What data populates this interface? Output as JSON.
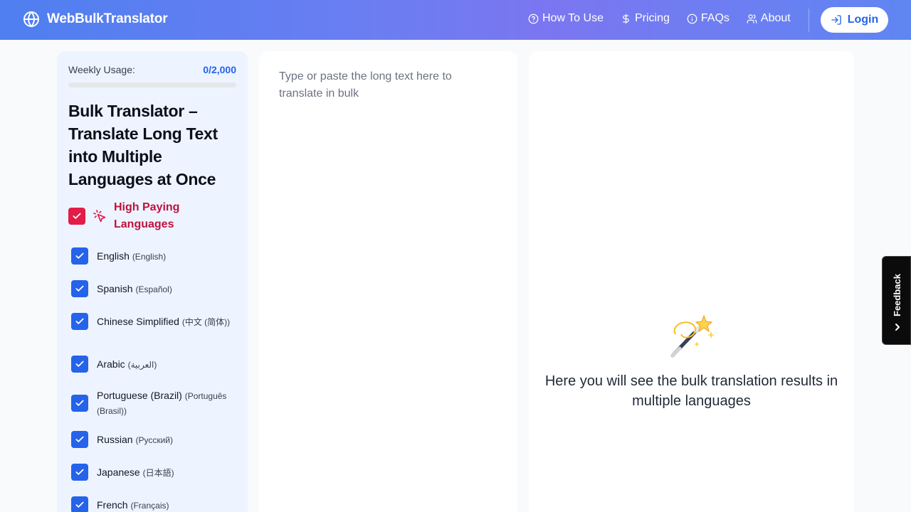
{
  "header": {
    "brand": "WebBulkTranslator",
    "nav": [
      {
        "label": "How To Use",
        "icon": "question-circle-icon"
      },
      {
        "label": "Pricing",
        "icon": "dollar-icon"
      },
      {
        "label": "FAQs",
        "icon": "info-circle-icon"
      },
      {
        "label": "About",
        "icon": "users-icon"
      }
    ],
    "login_label": "Login"
  },
  "sidebar": {
    "usage_label": "Weekly Usage:",
    "usage_value": "0/2,000",
    "usage_fraction": 0,
    "title": "Bulk Translator – Translate Long Text into Multiple Languages at Once",
    "high_paying_label": "High Paying Languages",
    "languages": [
      {
        "name": "English",
        "native": "(English)",
        "checked": true
      },
      {
        "name": "Spanish",
        "native": "(Español)",
        "checked": true
      },
      {
        "name": "Chinese Simplified",
        "native": "(中文 (简体))",
        "checked": true
      },
      {
        "name": "Arabic",
        "native": "(العربية)",
        "checked": true
      },
      {
        "name": "Portuguese (Brazil)",
        "native": "(Português (Brasil))",
        "checked": true
      },
      {
        "name": "Russian",
        "native": "(Русский)",
        "checked": true
      },
      {
        "name": "Japanese",
        "native": "(日本語)",
        "checked": true
      },
      {
        "name": "French",
        "native": "(Français)",
        "checked": true
      }
    ]
  },
  "input": {
    "placeholder": "Type or paste the long text here to translate in bulk",
    "value": ""
  },
  "output": {
    "message": "Here you will see the bulk translation results in multiple languages"
  },
  "feedback": {
    "label": "Feedback"
  },
  "colors": {
    "accent": "#2563eb",
    "high_paying": "#e11d48"
  }
}
